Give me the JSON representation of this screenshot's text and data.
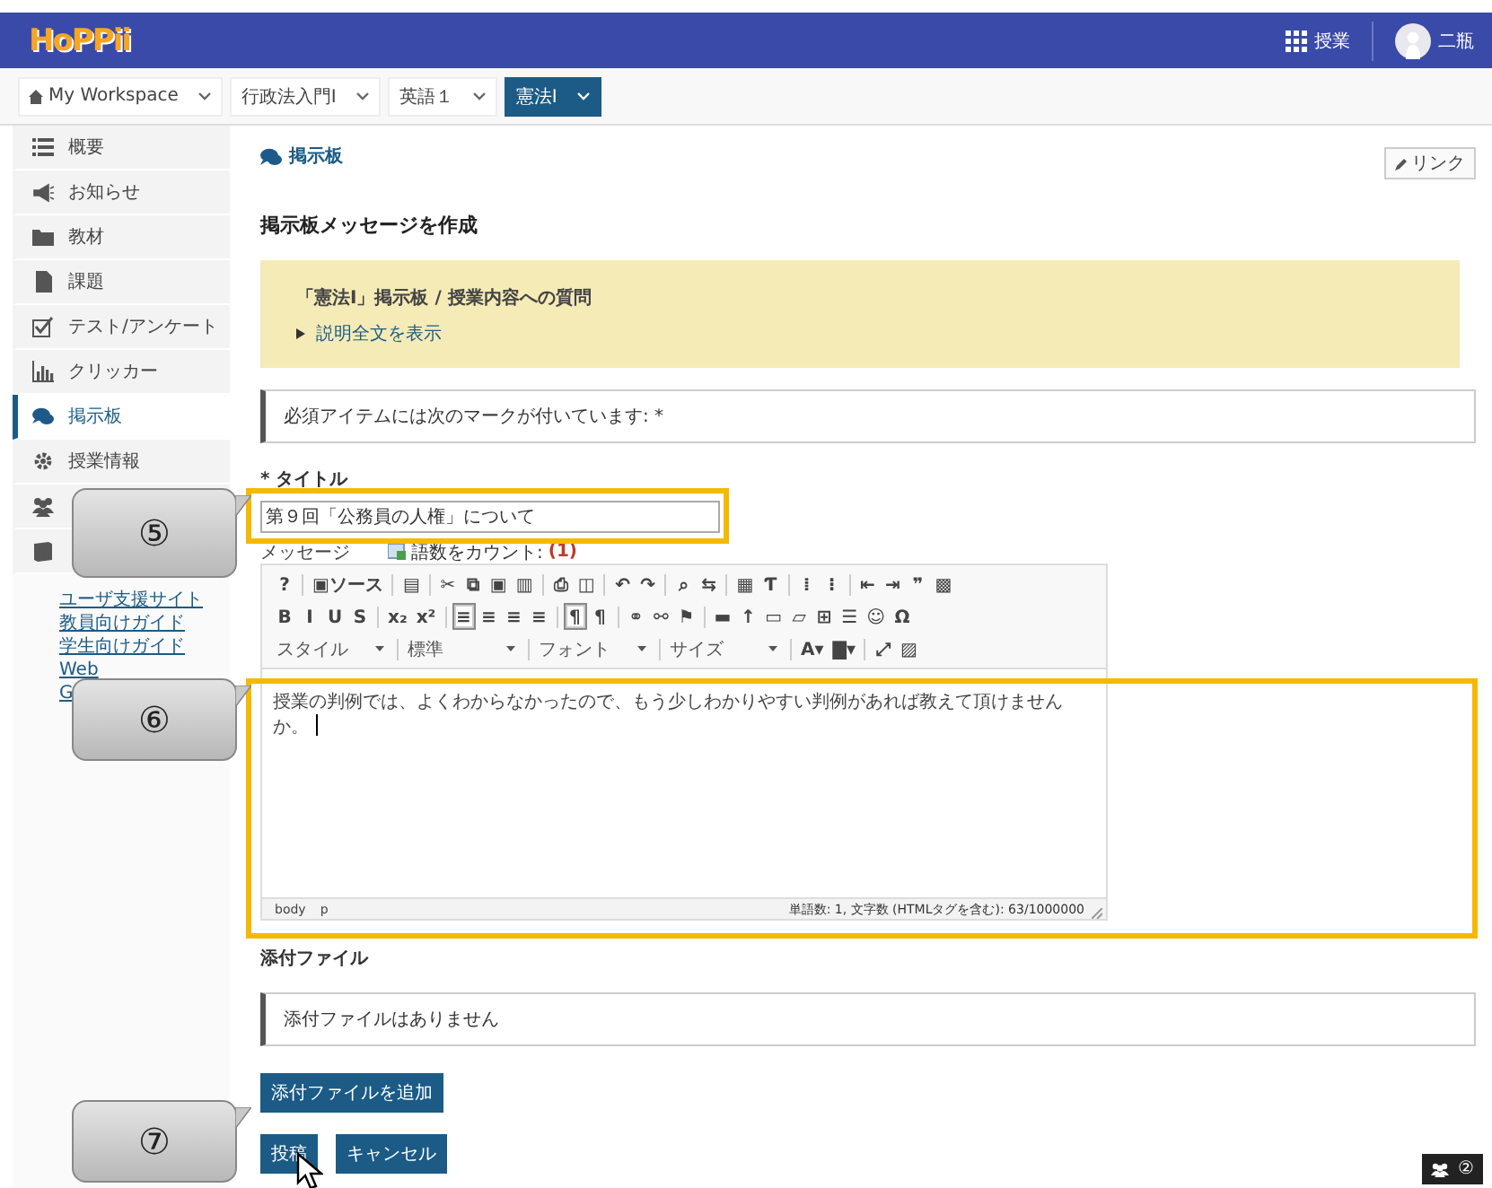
{
  "header": {
    "logo": "HoPPii",
    "apps_label": "授業",
    "user_name": "二瓶"
  },
  "site_tabs": [
    {
      "label": "My Workspace",
      "selected": false
    },
    {
      "label": "行政法入門Ⅰ",
      "selected": false
    },
    {
      "label": "英語１",
      "selected": false
    },
    {
      "label": "憲法Ⅰ",
      "selected": true
    }
  ],
  "sidebar": {
    "items": [
      {
        "label": "概要",
        "selected": false
      },
      {
        "label": "お知らせ",
        "selected": false
      },
      {
        "label": "教材",
        "selected": false
      },
      {
        "label": "課題",
        "selected": false
      },
      {
        "label": "テスト/アンケート",
        "selected": false
      },
      {
        "label": "クリッカー",
        "selected": false
      },
      {
        "label": "掲示板",
        "selected": true
      },
      {
        "label": "授業情報",
        "selected": false
      },
      {
        "selected": false
      },
      {
        "selected": false
      }
    ],
    "links": [
      "ユーザ支援サイト",
      "教員向けガイド",
      "学生向けガイド",
      "Web",
      "G"
    ]
  },
  "main": {
    "breadcrumb": "掲示板",
    "link_button": "リンク",
    "heading": "掲示板メッセージを作成",
    "topic": {
      "title": "「憲法Ⅰ」掲示板 / 授業内容への質問",
      "toggle": "説明全文を表示"
    },
    "required_note": "必須アイテムには次のマークが付いています: *",
    "title_label": "* タイトル",
    "title_value": "第９回「公務員の人権」について",
    "message_label": "メッセージ",
    "count_label": "語数をカウント:",
    "count_value": "(1)",
    "toolbar_rows": [
      [
        [
          {
            "kind": "button",
            "label": "?",
            "pressed": false
          }
        ],
        [
          {
            "kind": "button",
            "label": "▣ソース",
            "pressed": false
          }
        ],
        [
          {
            "kind": "button",
            "label": "▤",
            "pressed": false
          }
        ],
        [
          {
            "kind": "button",
            "label": "✂",
            "pressed": false
          },
          {
            "kind": "button",
            "label": "⧉",
            "pressed": false
          },
          {
            "kind": "button",
            "label": "▣",
            "pressed": false
          },
          {
            "kind": "button",
            "label": "▥",
            "pressed": false
          }
        ],
        [
          {
            "kind": "button",
            "label": "⎙",
            "pressed": false
          },
          {
            "kind": "button",
            "label": "◫",
            "pressed": false
          }
        ],
        [
          {
            "kind": "button",
            "label": "↶",
            "pressed": false
          },
          {
            "kind": "button",
            "label": "↷",
            "pressed": false
          }
        ],
        [
          {
            "kind": "button",
            "label": "⌕",
            "pressed": false
          },
          {
            "kind": "button",
            "label": "⇆",
            "pressed": false
          }
        ],
        [
          {
            "kind": "button",
            "label": "▦",
            "pressed": false
          },
          {
            "kind": "button",
            "label": "Ƭ",
            "pressed": false
          }
        ],
        [
          {
            "kind": "button",
            "label": "⁞",
            "pressed": false
          },
          {
            "kind": "button",
            "label": "⁝",
            "pressed": false
          }
        ],
        [
          {
            "kind": "button",
            "label": "⇤",
            "pressed": false
          },
          {
            "kind": "button",
            "label": "⇥",
            "pressed": false
          },
          {
            "kind": "button",
            "label": "❞",
            "pressed": false
          },
          {
            "kind": "button",
            "label": "▩",
            "pressed": false
          }
        ]
      ],
      [
        [
          {
            "kind": "button",
            "label": "B",
            "pressed": false
          },
          {
            "kind": "button",
            "label": "I",
            "pressed": false
          },
          {
            "kind": "button",
            "label": "U",
            "pressed": false
          },
          {
            "kind": "button",
            "label": "S",
            "pressed": false
          }
        ],
        [
          {
            "kind": "button",
            "label": "x₂",
            "pressed": false
          },
          {
            "kind": "button",
            "label": "x²",
            "pressed": false
          }
        ],
        [
          {
            "kind": "button",
            "label": "≡",
            "pressed": true
          },
          {
            "kind": "button",
            "label": "≡",
            "pressed": false
          },
          {
            "kind": "button",
            "label": "≡",
            "pressed": false
          },
          {
            "kind": "button",
            "label": "≡",
            "pressed": false
          }
        ],
        [
          {
            "kind": "button",
            "label": "¶",
            "pressed": true
          },
          {
            "kind": "button",
            "label": "¶",
            "pressed": false
          }
        ],
        [
          {
            "kind": "button",
            "label": "⚭",
            "pressed": false
          },
          {
            "kind": "button",
            "label": "⚯",
            "pressed": false
          },
          {
            "kind": "button",
            "label": "⚑",
            "pressed": false
          }
        ],
        [
          {
            "kind": "button",
            "label": "▬",
            "pressed": false
          },
          {
            "kind": "button",
            "label": "↑",
            "pressed": false
          },
          {
            "kind": "button",
            "label": "▭",
            "pressed": false
          },
          {
            "kind": "button",
            "label": "▱",
            "pressed": false
          },
          {
            "kind": "button",
            "label": "⊞",
            "pressed": false
          },
          {
            "kind": "button",
            "label": "☰",
            "pressed": false
          },
          {
            "kind": "button",
            "label": "☺",
            "pressed": false
          },
          {
            "kind": "button",
            "label": "Ω",
            "pressed": false
          }
        ]
      ],
      [
        [
          {
            "kind": "combo",
            "label": "スタイル"
          }
        ],
        [
          {
            "kind": "combo",
            "label": "標準"
          }
        ],
        [
          {
            "kind": "combo",
            "label": "フォント"
          }
        ],
        [
          {
            "kind": "combo",
            "label": "サイズ"
          }
        ],
        [
          {
            "kind": "button",
            "label": "A▾",
            "pressed": false
          },
          {
            "kind": "button",
            "label": "▇▾",
            "pressed": false
          }
        ],
        [
          {
            "kind": "button",
            "label": "⤢",
            "pressed": false
          },
          {
            "kind": "button",
            "label": "▨",
            "pressed": false
          }
        ]
      ]
    ],
    "message_body": "授業の判例では、よくわからなかったので、もう少しわかりやすい判例があれば教えて頂けませんか。",
    "status_path": [
      "body",
      "p"
    ],
    "status_count": "単語数: 1, 文字数 (HTMLタグを含む): 63/1000000",
    "attach_heading": "添付ファイル",
    "attach_note": "添付ファイルはありません",
    "attach_button": "添付ファイルを追加",
    "buttons": [
      "投稿",
      "キャンセル"
    ]
  },
  "presence": {
    "count": "②"
  },
  "callouts": [
    "⑤",
    "⑥",
    "⑦"
  ]
}
